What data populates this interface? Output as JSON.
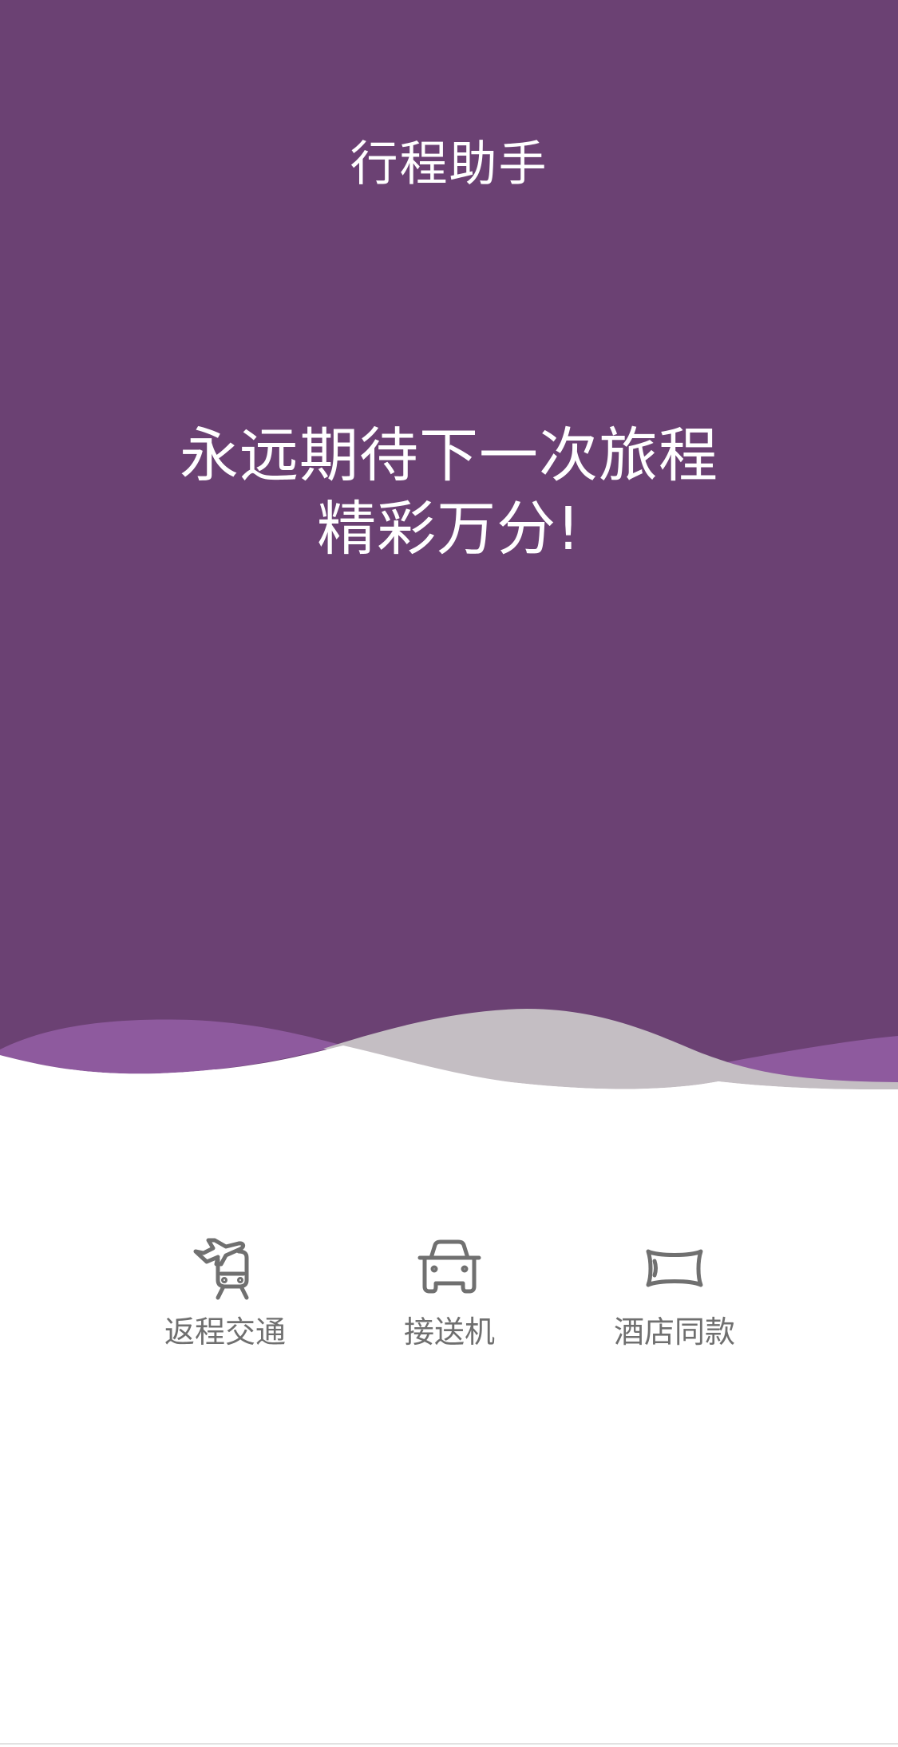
{
  "header": {
    "title": "行程助手"
  },
  "hero": {
    "slogan_line1": "永远期待下一次旅程",
    "slogan_line2": "精彩万分!"
  },
  "services": [
    {
      "label": "返程交通",
      "icon": "plane-train-icon"
    },
    {
      "label": "接送机",
      "icon": "car-icon"
    },
    {
      "label": "酒店同款",
      "icon": "pillow-icon"
    }
  ],
  "colors": {
    "hero_bg": "#6b4173",
    "wave_purple": "#8e5a9e",
    "wave_gray": "#c4bec3",
    "label_gray": "#6f6f6f",
    "icon_gray": "#707070"
  }
}
